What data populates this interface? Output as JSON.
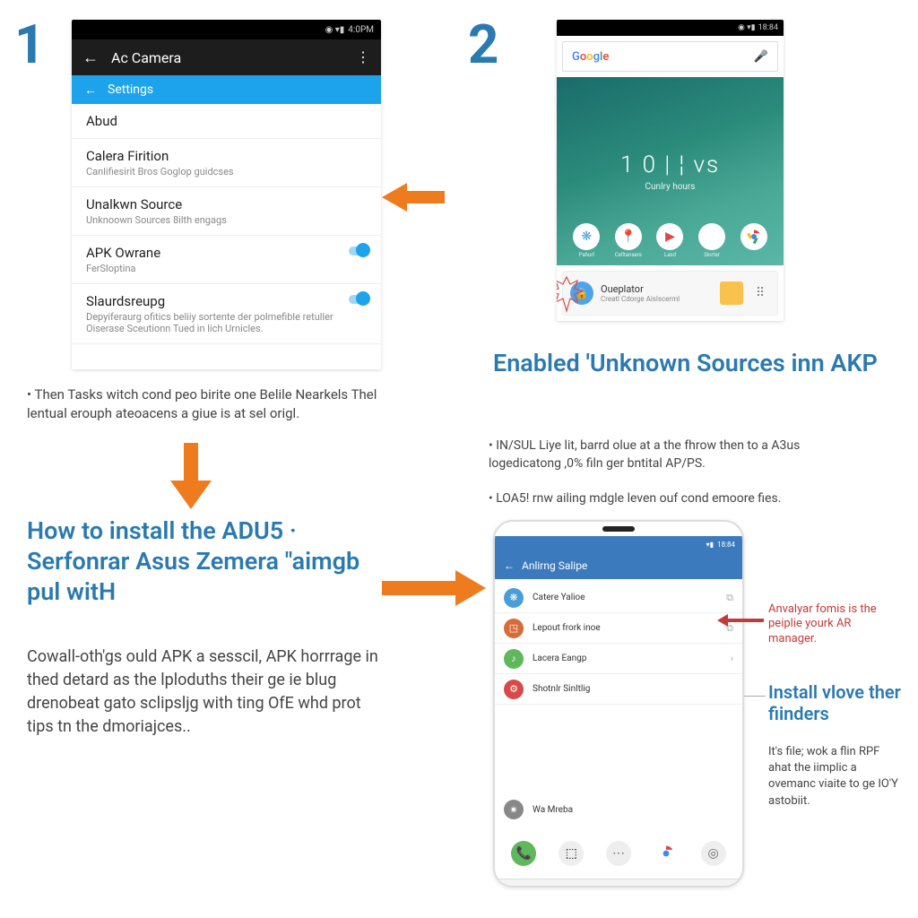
{
  "step1": {
    "num": "1",
    "status_time": "4:0PM",
    "appbar": {
      "title": "Ac Camera"
    },
    "tabbar": "Settings",
    "items": [
      {
        "t": "Abud",
        "sub": ""
      },
      {
        "t": "Calera Firition",
        "sub": "Canlifiesirit Bros Goglop guidcses"
      },
      {
        "t": "Unalkwn Source",
        "sub": "Unknoown Sources 8ilth engags"
      },
      {
        "t": "APK Owrane",
        "sub": "FerSloptina"
      },
      {
        "t": "Slaurdsreupg",
        "sub": "Depyiferaurg ofitics beliiy sortente der polmefible retuller Oiserase Sceutionn Tued in lich Urnicles."
      }
    ],
    "bullet": "Then Tasks witch cond peo birite one Belile Nearkels Thel lentual erouph ateoacens a giue is at sel origl.",
    "heading": "How to install the ADU5 · Serfonrar Asus Zemera \"aimgb pul witH",
    "body": "Cowall-oth'gs ould APK a sesscil, APK horrrage in thed detard as the lploduths their ge ie blug drenobeat gato sclipsljg with ting OfE whd prot tips tn the dmoriajces.."
  },
  "step2": {
    "num": "2",
    "status_time": "18:84",
    "search": "Google",
    "clock": "1 0 | ¦ vs",
    "clock_sub": "Cunlry hours",
    "icons": [
      {
        "lab": "Pahurl"
      },
      {
        "lab": "Celltansers"
      },
      {
        "lab": "Lasd"
      },
      {
        "lab": "Sinrter"
      },
      {
        "lab": ""
      }
    ],
    "card": {
      "t": "Oueplator",
      "s": "Creatl Cdorge Aislscerml"
    },
    "heading": "Enabled 'Unknown Sources inn AKP",
    "bullets": [
      "IN/SUL Liye lit, barrd olue at a the fhrow then to a A3us logedicatong ,0% filn ger bntital AP/PS.",
      "LOA5! rnw ailing mdgle leven ouf cond emoore fies."
    ]
  },
  "step3": {
    "status_time": "18:84",
    "bar": "Anlirng Salipe",
    "items": [
      {
        "t": "Catere Yalioe",
        "c": "#4a9ed8"
      },
      {
        "t": "Lepout frork inoe",
        "c": "#d86b3a"
      },
      {
        "t": "Lacera Eangp",
        "c": "#5fb85c"
      },
      {
        "t": "Shotnlr Sinltlig",
        "c": "#d84a4a"
      },
      {
        "t": "Wa Mreba",
        "c": "#888"
      }
    ],
    "ann_red": "Anvalyar fomis is the peiplie yourk AR manager.",
    "heading": "Install vlove ther fiinders",
    "body": "It's file; wok a flin RPF ahat the iimplic a ovemanc viaite to ge IO'Y astobiit."
  }
}
